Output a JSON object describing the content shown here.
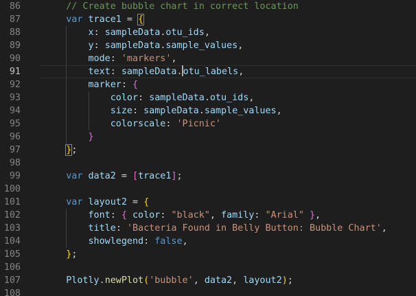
{
  "editor": {
    "language": "javascript",
    "current_line": "91",
    "lines": [
      {
        "n": "86",
        "indent": 1,
        "tokens": [
          {
            "t": "// Create bubble chart in correct location",
            "c": "cmt"
          }
        ]
      },
      {
        "n": "87",
        "indent": 1,
        "tokens": [
          {
            "t": "var",
            "c": "kw"
          },
          {
            "t": " ",
            "c": "op"
          },
          {
            "t": "trace1",
            "c": "var"
          },
          {
            "t": " = ",
            "c": "op"
          },
          {
            "t": "{",
            "c": "brace-gold match"
          }
        ]
      },
      {
        "n": "88",
        "indent": 2,
        "tokens": [
          {
            "t": "x",
            "c": "var"
          },
          {
            "t": ": ",
            "c": "op"
          },
          {
            "t": "sampleData",
            "c": "var"
          },
          {
            "t": ".",
            "c": "op"
          },
          {
            "t": "otu_ids",
            "c": "var"
          },
          {
            "t": ",",
            "c": "op"
          }
        ]
      },
      {
        "n": "89",
        "indent": 2,
        "tokens": [
          {
            "t": "y",
            "c": "var"
          },
          {
            "t": ": ",
            "c": "op"
          },
          {
            "t": "sampleData",
            "c": "var"
          },
          {
            "t": ".",
            "c": "op"
          },
          {
            "t": "sample_values",
            "c": "var"
          },
          {
            "t": ",",
            "c": "op"
          }
        ]
      },
      {
        "n": "90",
        "indent": 2,
        "tokens": [
          {
            "t": "mode",
            "c": "var"
          },
          {
            "t": ": ",
            "c": "op"
          },
          {
            "t": "'markers'",
            "c": "str"
          },
          {
            "t": ",",
            "c": "op"
          }
        ]
      },
      {
        "n": "91",
        "indent": 2,
        "tokens": [
          {
            "t": "text",
            "c": "var"
          },
          {
            "t": ": ",
            "c": "op"
          },
          {
            "t": "sampleData",
            "c": "var"
          },
          {
            "t": ".",
            "c": "op"
          },
          {
            "t": "",
            "c": "cursor"
          },
          {
            "t": "otu_labels",
            "c": "var"
          },
          {
            "t": ",",
            "c": "op"
          }
        ]
      },
      {
        "n": "92",
        "indent": 2,
        "tokens": [
          {
            "t": "marker",
            "c": "var"
          },
          {
            "t": ": ",
            "c": "op"
          },
          {
            "t": "{",
            "c": "brace"
          }
        ]
      },
      {
        "n": "93",
        "indent": 3,
        "tokens": [
          {
            "t": "color",
            "c": "var"
          },
          {
            "t": ": ",
            "c": "op"
          },
          {
            "t": "sampleData",
            "c": "var"
          },
          {
            "t": ".",
            "c": "op"
          },
          {
            "t": "otu_ids",
            "c": "var"
          },
          {
            "t": ",",
            "c": "op"
          }
        ]
      },
      {
        "n": "94",
        "indent": 3,
        "tokens": [
          {
            "t": "size",
            "c": "var"
          },
          {
            "t": ": ",
            "c": "op"
          },
          {
            "t": "sampleData",
            "c": "var"
          },
          {
            "t": ".",
            "c": "op"
          },
          {
            "t": "sample_values",
            "c": "var"
          },
          {
            "t": ",",
            "c": "op"
          }
        ]
      },
      {
        "n": "95",
        "indent": 3,
        "tokens": [
          {
            "t": "colorscale",
            "c": "var"
          },
          {
            "t": ": ",
            "c": "op"
          },
          {
            "t": "'Picnic'",
            "c": "str"
          }
        ]
      },
      {
        "n": "96",
        "indent": 2,
        "tokens": [
          {
            "t": "}",
            "c": "brace"
          }
        ]
      },
      {
        "n": "97",
        "indent": 1,
        "tokens": [
          {
            "t": "}",
            "c": "brace-gold match"
          },
          {
            "t": ";",
            "c": "op"
          }
        ]
      },
      {
        "n": "98",
        "indent": 0,
        "tokens": []
      },
      {
        "n": "99",
        "indent": 1,
        "tokens": [
          {
            "t": "var",
            "c": "kw"
          },
          {
            "t": " ",
            "c": "op"
          },
          {
            "t": "data2",
            "c": "var"
          },
          {
            "t": " = ",
            "c": "op"
          },
          {
            "t": "[",
            "c": "brace"
          },
          {
            "t": "trace1",
            "c": "var"
          },
          {
            "t": "]",
            "c": "brace"
          },
          {
            "t": ";",
            "c": "op"
          }
        ]
      },
      {
        "n": "100",
        "indent": 0,
        "tokens": []
      },
      {
        "n": "101",
        "indent": 1,
        "tokens": [
          {
            "t": "var",
            "c": "kw"
          },
          {
            "t": " ",
            "c": "op"
          },
          {
            "t": "layout2",
            "c": "var"
          },
          {
            "t": " = ",
            "c": "op"
          },
          {
            "t": "{",
            "c": "brace-gold"
          }
        ]
      },
      {
        "n": "102",
        "indent": 2,
        "tokens": [
          {
            "t": "font",
            "c": "var"
          },
          {
            "t": ": ",
            "c": "op"
          },
          {
            "t": "{",
            "c": "brace"
          },
          {
            "t": " ",
            "c": "op"
          },
          {
            "t": "color",
            "c": "var"
          },
          {
            "t": ": ",
            "c": "op"
          },
          {
            "t": "\"black\"",
            "c": "str"
          },
          {
            "t": ", ",
            "c": "op"
          },
          {
            "t": "family",
            "c": "var"
          },
          {
            "t": ": ",
            "c": "op"
          },
          {
            "t": "\"Arial\"",
            "c": "str"
          },
          {
            "t": " ",
            "c": "op"
          },
          {
            "t": "}",
            "c": "brace"
          },
          {
            "t": ",",
            "c": "op"
          }
        ]
      },
      {
        "n": "103",
        "indent": 2,
        "tokens": [
          {
            "t": "title",
            "c": "var"
          },
          {
            "t": ": ",
            "c": "op"
          },
          {
            "t": "'Bacteria Found in Belly Button: Bubble Chart'",
            "c": "str"
          },
          {
            "t": ",",
            "c": "op"
          }
        ]
      },
      {
        "n": "104",
        "indent": 2,
        "tokens": [
          {
            "t": "showlegend",
            "c": "var"
          },
          {
            "t": ": ",
            "c": "op"
          },
          {
            "t": "false",
            "c": "kw"
          },
          {
            "t": ",",
            "c": "op"
          }
        ]
      },
      {
        "n": "105",
        "indent": 1,
        "tokens": [
          {
            "t": "}",
            "c": "brace-gold"
          },
          {
            "t": ";",
            "c": "op"
          }
        ]
      },
      {
        "n": "106",
        "indent": 0,
        "tokens": []
      },
      {
        "n": "107",
        "indent": 1,
        "tokens": [
          {
            "t": "Plotly",
            "c": "var"
          },
          {
            "t": ".",
            "c": "op"
          },
          {
            "t": "newPlot",
            "c": "fn"
          },
          {
            "t": "(",
            "c": "brace-gold"
          },
          {
            "t": "'bubble'",
            "c": "str"
          },
          {
            "t": ", ",
            "c": "op"
          },
          {
            "t": "data2",
            "c": "var"
          },
          {
            "t": ", ",
            "c": "op"
          },
          {
            "t": "layout2",
            "c": "var"
          },
          {
            "t": ")",
            "c": "brace-gold"
          },
          {
            "t": ";",
            "c": "op"
          }
        ]
      },
      {
        "n": "108",
        "indent": 0,
        "tokens": []
      }
    ]
  },
  "colors": {
    "background": "#1e1e1e",
    "comment": "#6a9955",
    "keyword": "#569cd6",
    "variable": "#9cdcfe",
    "string": "#ce9178",
    "function": "#dcdcaa",
    "bracket_gold": "#ffd700",
    "bracket_purple": "#da70d6",
    "line_number": "#858585"
  }
}
